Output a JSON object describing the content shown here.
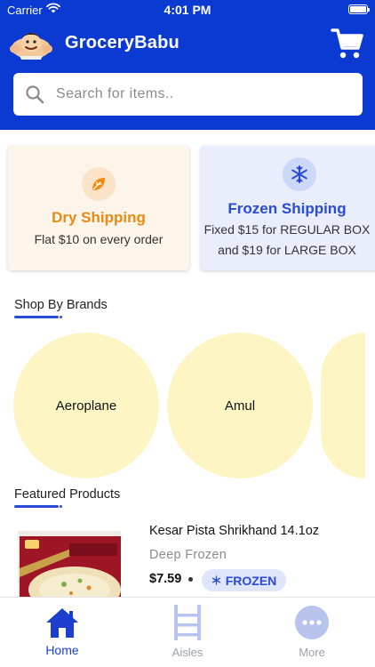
{
  "status_bar": {
    "carrier": "Carrier",
    "time": "4:01 PM"
  },
  "header": {
    "app_title": "GroceryBabu",
    "logo_icon": "mascot-logo",
    "cart_icon": "cart-icon"
  },
  "search": {
    "placeholder": "Search for items..",
    "value": ""
  },
  "shipping": {
    "dry": {
      "title": "Dry Shipping",
      "line1": "Flat $10 on every order",
      "icon": "leaf-icon",
      "color": "#e88a13"
    },
    "frozen": {
      "title": "Frozen Shipping",
      "line1": "Fixed $15 for REGULAR BOX",
      "line2": "and $19 for LARGE BOX",
      "icon": "snowflake-icon",
      "color": "#2a4bd9"
    }
  },
  "brands": {
    "section_title": "Shop By Brands",
    "items": [
      "Aeroplane",
      "Amul",
      ""
    ]
  },
  "featured": {
    "section_title": "Featured Products",
    "products": [
      {
        "name": "Kesar Pista Shrikhand 14.1oz",
        "category": "Deep Frozen",
        "price": "$7.59",
        "badge": "FROZEN"
      }
    ]
  },
  "tabs": [
    {
      "label": "Home",
      "icon": "home-icon",
      "active": true
    },
    {
      "label": "Aisles",
      "icon": "aisles-icon",
      "active": false
    },
    {
      "label": "More",
      "icon": "more-icon",
      "active": false
    }
  ],
  "colors": {
    "brand_blue": "#0a3ad1",
    "accent_blue": "#2a4bd9",
    "dry_orange": "#e88a13",
    "brand_circle": "#fdf6c4"
  }
}
